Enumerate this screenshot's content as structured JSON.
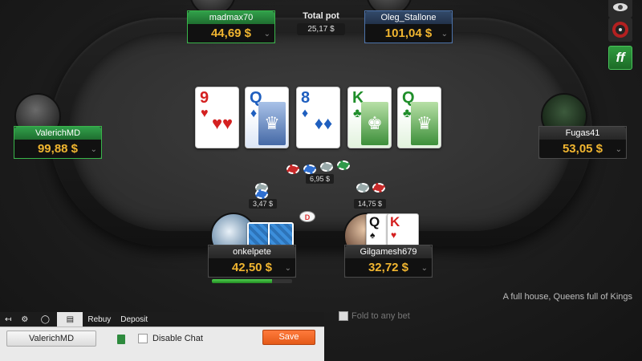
{
  "pot": {
    "label": "Total pot",
    "value": "25,17 $"
  },
  "players": {
    "madmax": {
      "name": "madmax70",
      "stack": "44,69 $"
    },
    "oleg": {
      "name": "Oleg_Stallone",
      "stack": "101,04 $"
    },
    "valerich": {
      "name": "ValerichMD",
      "stack": "99,88 $"
    },
    "fugas": {
      "name": "Fugas41",
      "stack": "53,05 $"
    },
    "onkel": {
      "name": "onkelpete",
      "stack": "42,50 $",
      "time_remaining_fraction": 0.75
    },
    "gilga": {
      "name": "Gilgamesh679",
      "stack": "32,72 $"
    }
  },
  "board": [
    {
      "rank": "9",
      "suit": "♥",
      "color": "#d42020"
    },
    {
      "rank": "Q",
      "suit": "♦",
      "color": "#1f5fbf"
    },
    {
      "rank": "8",
      "suit": "♦",
      "color": "#1f5fbf"
    },
    {
      "rank": "K",
      "suit": "♣",
      "color": "#1f8e2a"
    },
    {
      "rank": "Q",
      "suit": "♣",
      "color": "#1f8e2a"
    }
  ],
  "hole_cards_gilgamesh": [
    {
      "rank": "Q",
      "suit": "♠"
    },
    {
      "rank": "K",
      "suit": "♥"
    }
  ],
  "bets": {
    "center": "6,95 $",
    "left": "3,47 $",
    "right": "14,75 $"
  },
  "dealer_label": "D",
  "hand_text": "A full house, Queens full of Kings",
  "fold_any": "Fold to any bet",
  "icons": {
    "ff": "ff"
  },
  "tabs": {
    "rebuy": "Rebuy",
    "deposit": "Deposit"
  },
  "chat": {
    "user_button": "ValerichMD",
    "disable_chat": "Disable Chat",
    "save": "Save"
  },
  "colors": {
    "stack_gold": "#f0b530",
    "save_orange": "#e45a18",
    "timer_green": "#4ed04e"
  }
}
